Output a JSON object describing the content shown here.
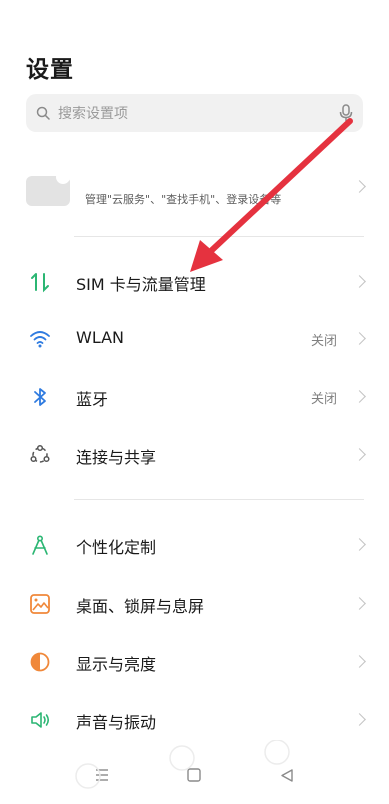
{
  "header": {
    "title": "设置"
  },
  "search": {
    "placeholder": "搜索设置项"
  },
  "account": {
    "subtitle": "管理\"云服务\"、\"查找手机\"、登录设备等"
  },
  "group1": [
    {
      "label": "SIM 卡与流量管理",
      "value": "",
      "icon": "sim-swap-icon"
    },
    {
      "label": "WLAN",
      "value": "关闭",
      "icon": "wifi-icon"
    },
    {
      "label": "蓝牙",
      "value": "关闭",
      "icon": "bluetooth-icon"
    },
    {
      "label": "连接与共享",
      "value": "",
      "icon": "share-connect-icon"
    }
  ],
  "group2": [
    {
      "label": "个性化定制",
      "icon": "personalize-icon"
    },
    {
      "label": "桌面、锁屏与息屏",
      "icon": "wallpaper-icon"
    },
    {
      "label": "显示与亮度",
      "icon": "brightness-icon"
    },
    {
      "label": "声音与振动",
      "icon": "sound-icon"
    }
  ],
  "colors": {
    "accent_green": "#2bb673",
    "accent_blue": "#2f7be0",
    "accent_orange": "#f0883a",
    "annotation_red": "#e5323f"
  }
}
